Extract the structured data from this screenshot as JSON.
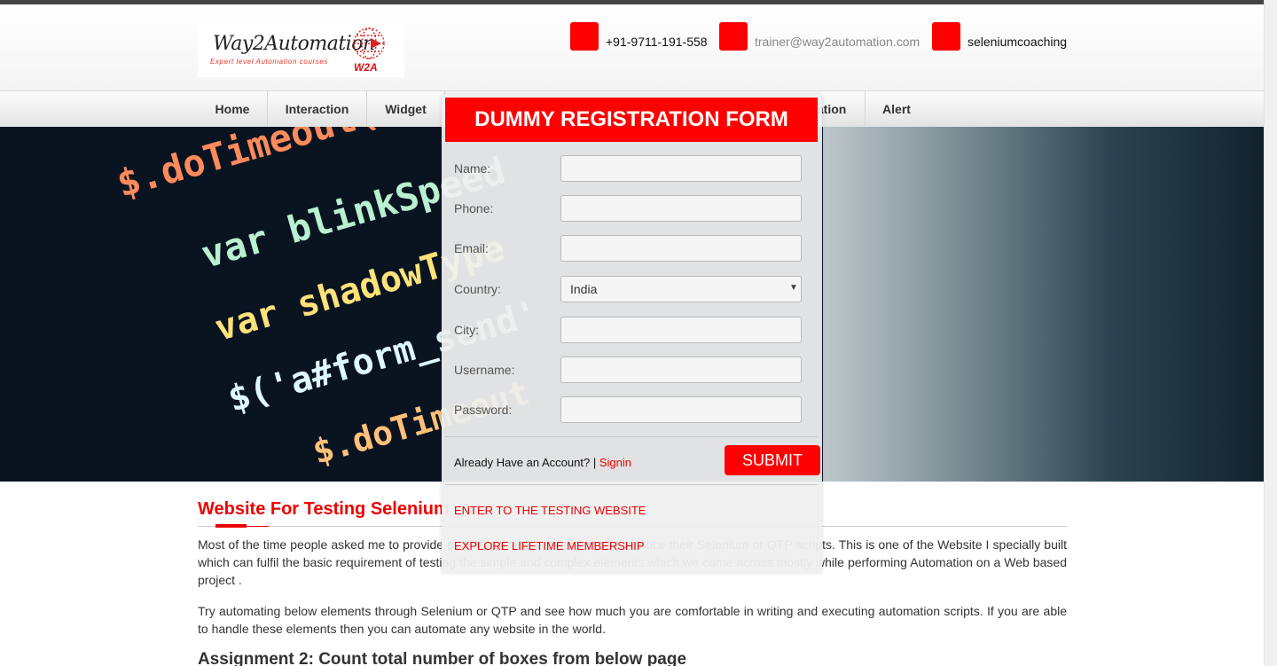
{
  "header": {
    "logo_title": "Way2Automation",
    "logo_tagline": "Expert level Automation courses",
    "logo_badge": "W2A",
    "phone": "+91-9711-191-558",
    "email": "trainer@way2automation.com",
    "skype": "seleniumcoaching"
  },
  "nav": {
    "items": [
      {
        "label": "Home"
      },
      {
        "label": "Interaction"
      },
      {
        "label": "Widget"
      },
      {
        "label": "Registration"
      },
      {
        "label": "Alert"
      }
    ]
  },
  "hero": {
    "code_lines": [
      "$.doTimeout('scro",
      "var blinkSpeed",
      "var shadowType",
      "$('a#form_send'",
      "$.doTimeout"
    ]
  },
  "modal": {
    "title": "DUMMY REGISTRATION FORM",
    "fields": [
      {
        "label": "Name:",
        "value": ""
      },
      {
        "label": "Phone:",
        "value": ""
      },
      {
        "label": "Email:",
        "value": ""
      },
      {
        "label": "Country:",
        "value": "India"
      },
      {
        "label": "City:",
        "value": ""
      },
      {
        "label": "Username:",
        "value": ""
      },
      {
        "label": "Password:",
        "value": ""
      }
    ],
    "already_text": "Already Have an Account? | ",
    "signin_label": "Signin",
    "submit_label": "SUBMIT",
    "enter_link": "ENTER TO THE TESTING WEBSITE",
    "membership_link": "EXPLORE LIFETIME MEMBERSHIP"
  },
  "content": {
    "section_title": "Website For Testing Selenium",
    "para1": "Most of the time people asked me to provide available WebElement and can practice their Selenium or QTP scripts. This is one of the Website I specially built which can fulfil the basic requirement of testing the simple and complex elements which we come across mostly while performing Automation on a Web based project .",
    "para2": "Try automating below elements through Selenium or QTP and see how much you are comfortable in writing and executing automation scripts. If you are able to handle these elements then you can automate any website in the world.",
    "assignment": "Assignment 2: Count total number of boxes from below page"
  },
  "colors": {
    "accent": "#ff0000",
    "nav_bg": "#e3e3e3",
    "hero_bg": "#0a1421"
  }
}
